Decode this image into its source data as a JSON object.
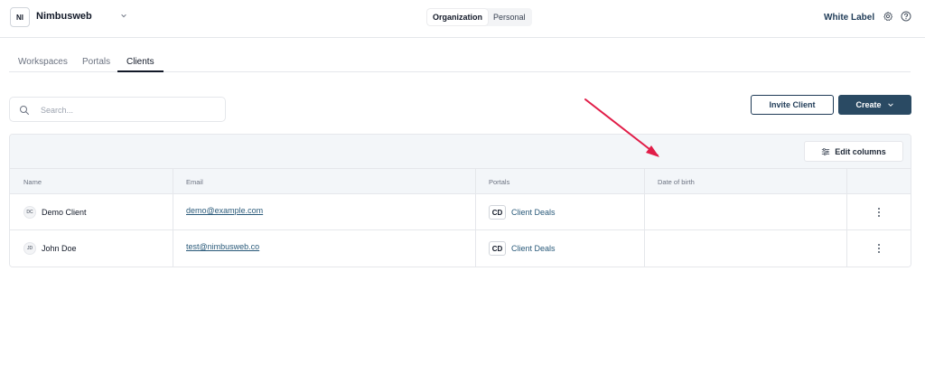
{
  "workspace": {
    "initials": "NI",
    "name": "Nimbusweb"
  },
  "context_toggle": {
    "options": [
      "Organization",
      "Personal"
    ],
    "selected": "Organization"
  },
  "header": {
    "white_label": "White Label"
  },
  "tabs": [
    {
      "label": "Workspaces",
      "active": false
    },
    {
      "label": "Portals",
      "active": false
    },
    {
      "label": "Clients",
      "active": true
    }
  ],
  "search": {
    "placeholder": "Search...",
    "value": ""
  },
  "actions": {
    "invite_label": "Invite Client",
    "create_label": "Create"
  },
  "table": {
    "edit_columns_label": "Edit columns",
    "columns": [
      "Name",
      "Email",
      "Portals",
      "Date of birth"
    ],
    "rows": [
      {
        "initials": "DC",
        "name": "Demo Client",
        "email": "demo@example.com",
        "portal_initials": "CD",
        "portal_name": "Client Deals",
        "date_of_birth": ""
      },
      {
        "initials": "JD",
        "name": "John Doe",
        "email": "test@nimbusweb.co",
        "portal_initials": "CD",
        "portal_name": "Client Deals",
        "date_of_birth": ""
      }
    ]
  },
  "colors": {
    "accent": "#2a4a63",
    "link": "#2a5a7a",
    "annotation_arrow": "#e11d48"
  },
  "icons": [
    "chevron-down-icon",
    "gear-icon",
    "help-icon",
    "search-icon",
    "columns-icon",
    "kebab-icon",
    "annotation-arrow"
  ]
}
